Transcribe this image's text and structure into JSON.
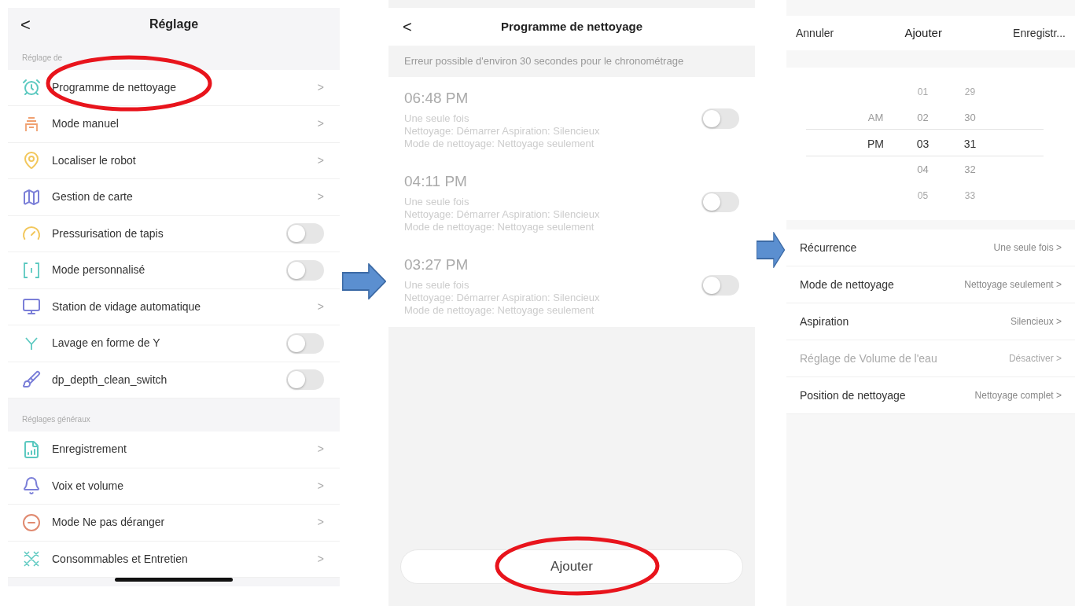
{
  "settings": {
    "title": "Réglage",
    "back": "<",
    "sections": [
      {
        "label": "Réglage de",
        "items": [
          {
            "label": "Programme de nettoyage",
            "kind": "link",
            "chevron": ">"
          },
          {
            "label": "Mode manuel",
            "kind": "link",
            "chevron": ">"
          },
          {
            "label": "Localiser le robot",
            "kind": "link",
            "chevron": ">"
          },
          {
            "label": "Gestion de carte",
            "kind": "link",
            "chevron": ">"
          },
          {
            "label": "Pressurisation de tapis",
            "kind": "toggle",
            "on": false
          },
          {
            "label": "Mode personnalisé",
            "kind": "toggle",
            "on": false
          },
          {
            "label": "Station de vidage automatique",
            "kind": "link",
            "chevron": ">"
          },
          {
            "label": "Lavage en forme de Y",
            "kind": "toggle",
            "on": false
          },
          {
            "label": "dp_depth_clean_switch",
            "kind": "toggle",
            "on": false
          }
        ]
      },
      {
        "label": "Réglages généraux",
        "items": [
          {
            "label": "Enregistrement",
            "kind": "link",
            "chevron": ">"
          },
          {
            "label": "Voix et volume",
            "kind": "link",
            "chevron": ">"
          },
          {
            "label": "Mode Ne pas déranger",
            "kind": "link",
            "chevron": ">"
          },
          {
            "label": "Consommables et Entretien",
            "kind": "link",
            "chevron": ">"
          }
        ]
      }
    ]
  },
  "schedule": {
    "title": "Programme de nettoyage",
    "back": "<",
    "notice": "Erreur possible d'environ 30 secondes pour le chronométrage",
    "entries": [
      {
        "time": "06:48 PM",
        "recurrence": "Une seule fois",
        "details": [
          "Nettoyage: Démarrer Aspiration: Silencieux",
          "Mode de nettoyage: Nettoyage seulement"
        ],
        "on": false
      },
      {
        "time": "04:11 PM",
        "recurrence": "Une seule fois",
        "details": [
          "Nettoyage: Démarrer Aspiration: Silencieux",
          "Mode de nettoyage: Nettoyage seulement"
        ],
        "on": false
      },
      {
        "time": "03:27 PM",
        "recurrence": "Une seule fois",
        "details": [
          "Nettoyage: Démarrer Aspiration: Silencieux",
          "Mode de nettoyage: Nettoyage seulement"
        ],
        "on": false
      }
    ],
    "add_button": "Ajouter"
  },
  "add": {
    "cancel": "Annuler",
    "title": "Ajouter",
    "save": "Enregistr...",
    "picker": [
      [
        {
          "text": "AM",
          "selected": false
        },
        {
          "text": "PM",
          "selected": true
        }
      ],
      [
        {
          "text": "01",
          "selected": false
        },
        {
          "text": "02",
          "selected": false
        },
        {
          "text": "03",
          "selected": true
        },
        {
          "text": "04",
          "selected": false
        },
        {
          "text": "05",
          "selected": false
        }
      ],
      [
        {
          "text": "29",
          "selected": false
        },
        {
          "text": "30",
          "selected": false
        },
        {
          "text": "31",
          "selected": true
        },
        {
          "text": "32",
          "selected": false
        },
        {
          "text": "33",
          "selected": false
        }
      ]
    ],
    "rows": [
      {
        "label": "Récurrence",
        "value": "Une seule fois",
        "chevron": ">",
        "disabled": false
      },
      {
        "label": "Mode de nettoyage",
        "value": "Nettoyage seulement",
        "chevron": ">",
        "disabled": false
      },
      {
        "label": "Aspiration",
        "value": "Silencieux",
        "chevron": ">",
        "disabled": false
      },
      {
        "label": "Réglage de Volume de l'eau",
        "value": "Désactiver",
        "chevron": ">",
        "disabled": true
      },
      {
        "label": "Position de nettoyage",
        "value": "Nettoyage complet",
        "chevron": ">",
        "disabled": false
      }
    ]
  }
}
